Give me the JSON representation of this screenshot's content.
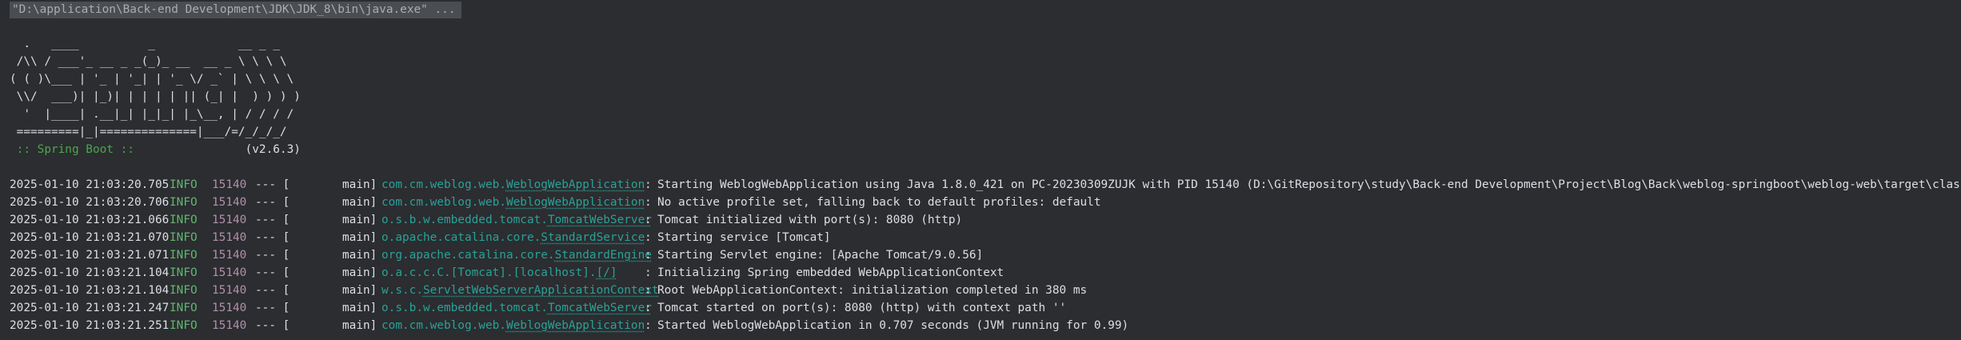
{
  "console": {
    "command_line": "\"D:\\application\\Back-end Development\\JDK\\JDK_8\\bin\\java.exe\" ...",
    "banner_lines": [
      "  .   ____          _            __ _ _",
      " /\\\\ / ___'_ __ _ _(_)_ __  __ _ \\ \\ \\ \\",
      "( ( )\\___ | '_ | '_| | '_ \\/ _` | \\ \\ \\ \\",
      " \\\\/  ___)| |_)| | | | | || (_| |  ) ) ) )",
      "  '  |____| .__|_| |_|_| |_\\__, | / / / /",
      " =========|_|==============|___/=/_/_/_/"
    ],
    "boot": {
      "label": " :: Spring Boot :: ",
      "version": "(v2.6.3)"
    },
    "log_lines": [
      {
        "timestamp": "2025-01-10 21:03:20.705",
        "level": "INFO",
        "pid": "15140",
        "sep": "--- [",
        "thread": "main]",
        "logger_pkg": "com.cm.weblog.web.",
        "logger_cls": "WeblogWebApplication",
        "message": "Starting WeblogWebApplication using Java 1.8.0_421 on PC-20230309ZUJK with PID 15140 (D:\\GitRepository\\study\\Back-end Development\\Project\\Blog\\Back\\weblog-springboot\\weblog-web\\target\\classes started by"
      },
      {
        "timestamp": "2025-01-10 21:03:20.706",
        "level": "INFO",
        "pid": "15140",
        "sep": "--- [",
        "thread": "main]",
        "logger_pkg": "com.cm.weblog.web.",
        "logger_cls": "WeblogWebApplication",
        "message": "No active profile set, falling back to default profiles: default"
      },
      {
        "timestamp": "2025-01-10 21:03:21.066",
        "level": "INFO",
        "pid": "15140",
        "sep": "--- [",
        "thread": "main]",
        "logger_pkg": "o.s.b.w.embedded.tomcat.",
        "logger_cls": "TomcatWebServer",
        "message": "Tomcat initialized with port(s): 8080 (http)"
      },
      {
        "timestamp": "2025-01-10 21:03:21.070",
        "level": "INFO",
        "pid": "15140",
        "sep": "--- [",
        "thread": "main]",
        "logger_pkg": "o.apache.catalina.core.",
        "logger_cls": "StandardService",
        "message": "Starting service [Tomcat]"
      },
      {
        "timestamp": "2025-01-10 21:03:21.071",
        "level": "INFO",
        "pid": "15140",
        "sep": "--- [",
        "thread": "main]",
        "logger_pkg": "org.apache.catalina.core.",
        "logger_cls": "StandardEngine",
        "message": "Starting Servlet engine: [Apache Tomcat/9.0.56]"
      },
      {
        "timestamp": "2025-01-10 21:03:21.104",
        "level": "INFO",
        "pid": "15140",
        "sep": "--- [",
        "thread": "main]",
        "logger_pkg": "o.a.c.c.C.[Tomcat].[localhost].",
        "logger_cls": "[/]",
        "message": "Initializing Spring embedded WebApplicationContext"
      },
      {
        "timestamp": "2025-01-10 21:03:21.104",
        "level": "INFO",
        "pid": "15140",
        "sep": "--- [",
        "thread": "main]",
        "logger_pkg": "w.s.c.",
        "logger_cls": "ServletWebServerApplicationContext",
        "message": "Root WebApplicationContext: initialization completed in 380 ms"
      },
      {
        "timestamp": "2025-01-10 21:03:21.247",
        "level": "INFO",
        "pid": "15140",
        "sep": "--- [",
        "thread": "main]",
        "logger_pkg": "o.s.b.w.embedded.tomcat.",
        "logger_cls": "TomcatWebServer",
        "message": "Tomcat started on port(s): 8080 (http) with context path ''"
      },
      {
        "timestamp": "2025-01-10 21:03:21.251",
        "level": "INFO",
        "pid": "15140",
        "sep": "--- [",
        "thread": "main]",
        "logger_pkg": "com.cm.weblog.web.",
        "logger_cls": "WeblogWebApplication",
        "message": "Started WeblogWebApplication in 0.707 seconds (JVM running for 0.99)"
      }
    ]
  },
  "colors": {
    "background": "#2b2d30",
    "text": "#dcdfe4",
    "level_info": "#5fb86e",
    "pid": "#b48ead",
    "logger": "#2aa198",
    "boot_label": "#4ca64c"
  }
}
